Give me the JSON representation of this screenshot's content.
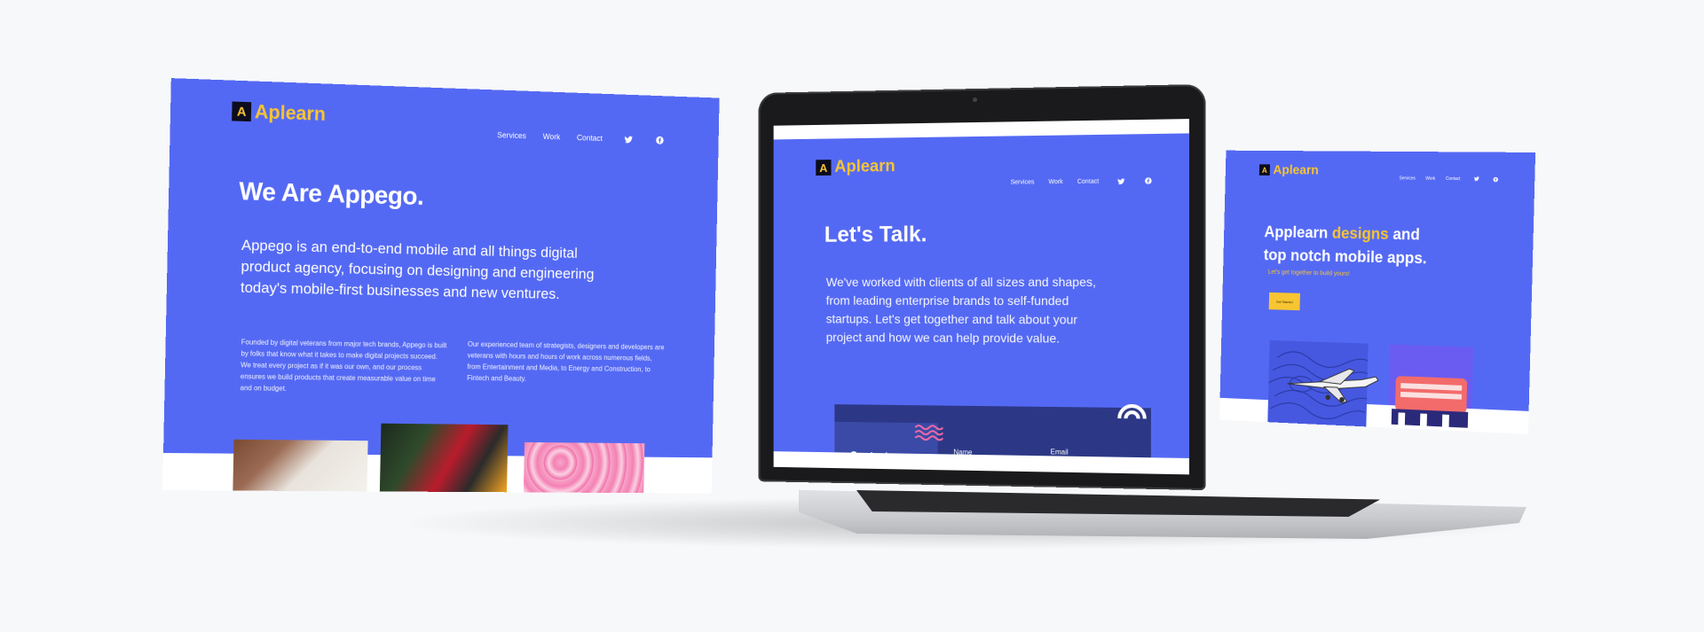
{
  "left_panel": {
    "brand": "Aplearn",
    "nav": [
      "Services",
      "Work",
      "Contact"
    ],
    "social_icons": [
      "twitter-icon",
      "facebook-icon"
    ],
    "heading": "We Are Appego.",
    "lead": "Appego is an end-to-end mobile and all things digital product agency, focusing on designing and engineering today's mobile-first businesses and new ventures.",
    "col1": "Founded by digital veterans from major tech brands, Appego is built by folks that know what it takes to make digital projects succeed. We treat every project as if it was our own, and our process ensures we build products that create measurable value on time and on budget.",
    "col2": "Our experienced team of strategists, designers and developers are veterans with hours and hours of work across numerous fields, from Entertainment and Media, to Energy and Construction, to Fintech and Beauty."
  },
  "laptop": {
    "brand": "Aplearn",
    "nav": [
      "Services",
      "Work",
      "Contact"
    ],
    "social_icons": [
      "twitter-icon",
      "facebook-icon"
    ],
    "heading": "Let's Talk.",
    "lead": "We've worked with clients of all sizes and shapes, from leading enterprise brands to self-funded startups. Let's get together and talk about your project and how we can help provide value.",
    "contact_title": "Contact Information",
    "name_label": "Name",
    "email_label": "Email"
  },
  "right_panel": {
    "brand": "Aplearn",
    "nav": [
      "Services",
      "Work",
      "Contact"
    ],
    "social_icons": [
      "twitter-icon",
      "facebook-icon"
    ],
    "heading_pre": "Applearn",
    "heading_accent": "designs",
    "heading_post": "and top notch mobile apps.",
    "subtitle": "Let's get together to build yours!",
    "cta_label": "Get Started"
  },
  "colors": {
    "brand_blue": "#5469f3",
    "accent_yellow": "#f7c531",
    "navy": "#2c3886",
    "background": "#f7f8fa"
  }
}
